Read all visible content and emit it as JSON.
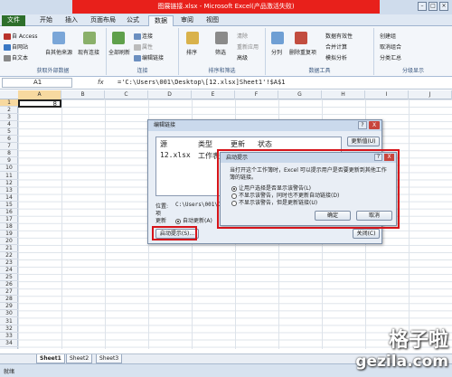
{
  "window": {
    "title": "图展链接.xlsx - Microsoft Excel(产品激活失败)"
  },
  "tabs": [
    "文件",
    "开始",
    "插入",
    "页面布局",
    "公式",
    "数据",
    "审阅",
    "视图"
  ],
  "ribbon": {
    "get_external": {
      "items": [
        "自 Access",
        "自网站",
        "自文本",
        "自其他来源",
        "现有连接"
      ],
      "label": "获取外部数据"
    },
    "connections": {
      "items": [
        "全部刷新",
        "连接",
        "属性",
        "编辑链接"
      ],
      "label": "连接"
    },
    "sort_filter": {
      "items": [
        "排序",
        "筛选",
        "清除",
        "重新应用",
        "高级"
      ],
      "label": "排序和筛选"
    },
    "data_tools": {
      "items": [
        "分列",
        "删除重复项",
        "数据有效性",
        "合并计算",
        "模拟分析"
      ],
      "label": "数据工具"
    },
    "outline": {
      "items": [
        "创建组",
        "取消组合",
        "分类汇总"
      ],
      "label": "分级显示"
    }
  },
  "formula_bar": {
    "name_box": "A1",
    "fx": "fx",
    "formula": "='C:\\Users\\001\\Desktop\\[12.xlsx]Sheet1'!$A$1"
  },
  "grid": {
    "columns": [
      "A",
      "B",
      "C",
      "D",
      "E",
      "F",
      "G",
      "H",
      "I",
      "J"
    ],
    "rows": [
      "1",
      "2",
      "3",
      "4",
      "5",
      "6",
      "7",
      "8",
      "9",
      "10",
      "11",
      "12",
      "13",
      "14",
      "15",
      "16",
      "17",
      "18",
      "19",
      "20",
      "21",
      "22",
      "23",
      "24",
      "25",
      "26",
      "27",
      "28",
      "29",
      "30",
      "31",
      "32",
      "33",
      "34"
    ],
    "a1_value": "8"
  },
  "sheets": [
    "Sheet1",
    "Sheet2",
    "Sheet3"
  ],
  "status": "就绪",
  "edit_links_dialog": {
    "title": "编辑链接",
    "help": "?",
    "close": "X",
    "headers": [
      "源",
      "类型",
      "更新",
      "状态"
    ],
    "row": {
      "source": "12.xlsx",
      "type": "工作表"
    },
    "location_label": "位置:",
    "location_value": "C:\\Users\\001\\Desk",
    "item_label": "项",
    "update_label": "更新",
    "auto_update": "自动更新(A)",
    "update_values_button": "更新值(U)",
    "startup_prompt_button": "启动提示(S)...",
    "close_button": "关闭(C)"
  },
  "startup_dialog": {
    "title": "启动提示",
    "help": "?",
    "close": "X",
    "message": "当打开这个工作簿时，Excel 可以提示用户是否要更新到其他工作簿的链接。",
    "options": [
      "让用户选择是否显示该警告(L)",
      "不显示该警告，同时也不更新自动链接(D)",
      "不显示该警告，但是更新链接(U)"
    ],
    "ok": "确定",
    "cancel": "取消"
  },
  "watermark": {
    "line1": "格子啦",
    "line2": "gezila.com"
  },
  "colors": {
    "title_red": "#e8201b",
    "file_tab": "#2e6f2b",
    "highlight_red": "#d6141a"
  }
}
